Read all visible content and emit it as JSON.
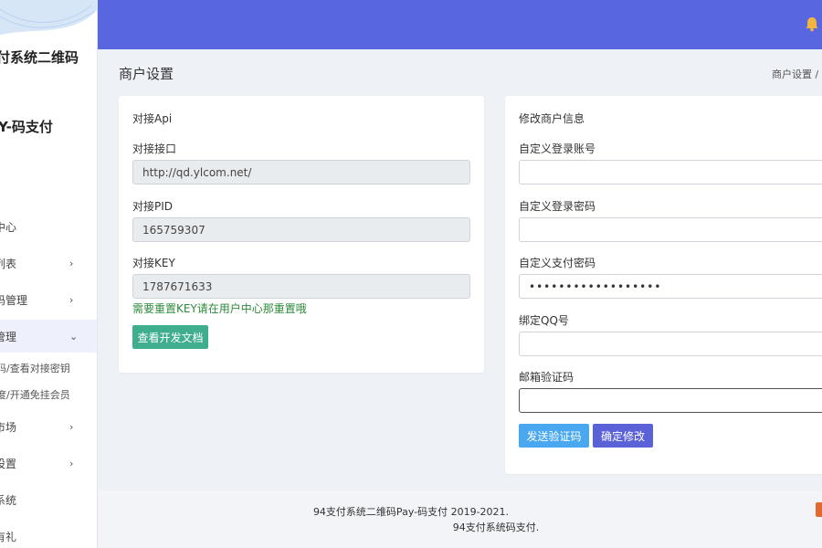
{
  "sidebar": {
    "brand_line1": "付系统二维码",
    "brand_line2": "Y-码支付",
    "items": [
      {
        "label": "中心"
      },
      {
        "label": "列表",
        "chevron": "›"
      },
      {
        "label": "码管理",
        "chevron": "›"
      },
      {
        "label": "管理",
        "chevron": "⌄"
      },
      {
        "label": "码/查看对接密钥"
      },
      {
        "label": "度/开通免挂会员"
      },
      {
        "label": "市场",
        "chevron": "›"
      },
      {
        "label": "设置",
        "chevron": "›"
      },
      {
        "label": "系统"
      },
      {
        "label": "有礼"
      }
    ]
  },
  "header": {
    "title": "商户设置",
    "breadcrumb": "商户设置  /"
  },
  "api_card": {
    "title": "对接Api",
    "endpoint_label": "对接接口",
    "endpoint_value": "http://qd.ylcom.net/",
    "pid_label": "对接PID",
    "pid_value": "165759307",
    "key_label": "对接KEY",
    "key_value": "1787671633",
    "hint": "需要重置KEY请在用户中心那重置哦",
    "docs_button": "查看开发文档"
  },
  "profile_card": {
    "title": "修改商户信息",
    "login_account_label": "自定义登录账号",
    "login_account_value": "",
    "login_password_label": "自定义登录密码",
    "login_password_value": "",
    "pay_password_label": "自定义支付密码",
    "pay_password_value": "••••••••••••••••••",
    "qq_label": "绑定QQ号",
    "qq_value": "",
    "email_code_label": "邮箱验证码",
    "email_code_value": "",
    "send_code_button": "发送验证码",
    "confirm_button": "确定修改"
  },
  "footer": {
    "line1": "94支付系统二维码Pay-码支付 2019-2021.",
    "line2": "94支付系统码支付."
  },
  "colors": {
    "topbar": "#5866e0",
    "docs_button": "#3fae8f",
    "send_button": "#4aa8f0",
    "confirm_button": "#5b62d8",
    "hint": "#2d8a3a"
  }
}
